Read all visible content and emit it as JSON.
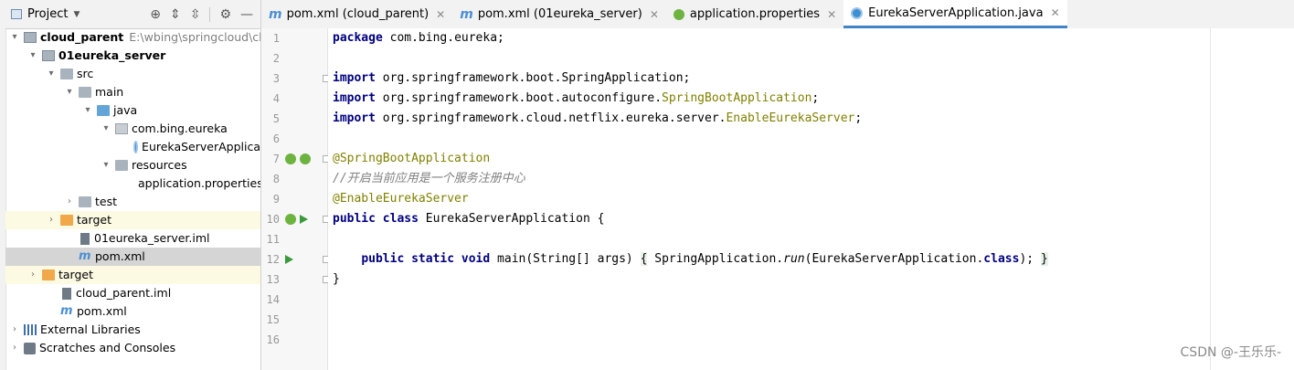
{
  "project_panel": {
    "title": "Project",
    "tree": [
      {
        "label": "cloud_parent",
        "path": "E:\\wbing\\springcloud\\clou",
        "bold": true,
        "indent": 0,
        "arrow": "▾",
        "icon": "module"
      },
      {
        "label": "01eureka_server",
        "bold": true,
        "indent": 1,
        "arrow": "▾",
        "icon": "module"
      },
      {
        "label": "src",
        "indent": 2,
        "arrow": "▾",
        "icon": "folder"
      },
      {
        "label": "main",
        "indent": 3,
        "arrow": "▾",
        "icon": "folder"
      },
      {
        "label": "java",
        "indent": 4,
        "arrow": "▾",
        "icon": "folder-blue"
      },
      {
        "label": "com.bing.eureka",
        "indent": 5,
        "arrow": "▾",
        "icon": "pkg"
      },
      {
        "label": "EurekaServerApplica",
        "indent": 6,
        "arrow": "",
        "icon": "javac"
      },
      {
        "label": "resources",
        "indent": 5,
        "arrow": "▾",
        "icon": "folder-res",
        "offset": -1
      },
      {
        "label": "application.properties",
        "indent": 6,
        "arrow": "",
        "icon": "leaf-green",
        "offset": -1
      },
      {
        "label": "test",
        "indent": 3,
        "arrow": "›",
        "icon": "folder"
      },
      {
        "label": "target",
        "indent": 2,
        "arrow": "›",
        "icon": "folder-orange",
        "highlight": true
      },
      {
        "label": "01eureka_server.iml",
        "indent": 3,
        "arrow": "",
        "icon": "iml"
      },
      {
        "label": "pom.xml",
        "indent": 3,
        "arrow": "",
        "icon": "mvn",
        "selected": true
      },
      {
        "label": "target",
        "indent": 1,
        "arrow": "›",
        "icon": "folder-orange",
        "highlight": true
      },
      {
        "label": "cloud_parent.iml",
        "indent": 2,
        "arrow": "",
        "icon": "iml"
      },
      {
        "label": "pom.xml",
        "indent": 2,
        "arrow": "",
        "icon": "mvn"
      },
      {
        "label": "External Libraries",
        "indent": 0,
        "arrow": "›",
        "icon": "lib"
      },
      {
        "label": "Scratches and Consoles",
        "indent": 0,
        "arrow": "›",
        "icon": "scr"
      }
    ]
  },
  "tabs": [
    {
      "label": "pom.xml (cloud_parent)",
      "icon": "m",
      "active": false
    },
    {
      "label": "pom.xml (01eureka_server)",
      "icon": "m",
      "active": false
    },
    {
      "label": "application.properties",
      "icon": "leaf",
      "active": false
    },
    {
      "label": "EurekaServerApplication.java",
      "icon": "java",
      "active": true
    }
  ],
  "code": {
    "line_numbers": [
      "1",
      "2",
      "3",
      "4",
      "5",
      "6",
      "7",
      "8",
      "9",
      "10",
      "11",
      "12",
      "13",
      "14",
      "15",
      "16"
    ],
    "lines": [
      [
        {
          "t": "package",
          "c": "kw"
        },
        {
          "t": " com.bing.eureka;"
        }
      ],
      [],
      [
        {
          "t": "import",
          "c": "kw"
        },
        {
          "t": " org.springframework.boot.SpringApplication;"
        }
      ],
      [
        {
          "t": "import",
          "c": "kw"
        },
        {
          "t": " org.springframework.boot.autoconfigure."
        },
        {
          "t": "SpringBootApplication",
          "c": "ann"
        },
        {
          "t": ";"
        }
      ],
      [
        {
          "t": "import",
          "c": "kw"
        },
        {
          "t": " org.springframework.cloud.netflix.eureka.server."
        },
        {
          "t": "EnableEurekaServer",
          "c": "ann"
        },
        {
          "t": ";"
        }
      ],
      [],
      [
        {
          "t": "@SpringBootApplication",
          "c": "ann"
        }
      ],
      [
        {
          "t": "//开启当前应用是一个服务注册中心",
          "c": "cm"
        }
      ],
      [
        {
          "t": "@EnableEurekaServer",
          "c": "ann"
        }
      ],
      [
        {
          "t": "public",
          "c": "kw"
        },
        {
          "t": " "
        },
        {
          "t": "class",
          "c": "kw"
        },
        {
          "t": " EurekaServerApplication {"
        }
      ],
      [],
      [
        {
          "t": "    "
        },
        {
          "t": "public",
          "c": "kw"
        },
        {
          "t": " "
        },
        {
          "t": "static",
          "c": "kw"
        },
        {
          "t": " "
        },
        {
          "t": "void",
          "c": "kw"
        },
        {
          "t": " main(String[] args) "
        },
        {
          "t": "{",
          "c": "brace"
        },
        {
          "t": " SpringApplication."
        },
        {
          "t": "run",
          "c": "it"
        },
        {
          "t": "(EurekaServerApplication."
        },
        {
          "t": "class",
          "c": "kw"
        },
        {
          "t": "); "
        },
        {
          "t": "}",
          "c": "brace"
        }
      ],
      [
        {
          "t": "}"
        }
      ],
      [],
      [],
      []
    ]
  },
  "watermark": "CSDN @-王乐乐-"
}
